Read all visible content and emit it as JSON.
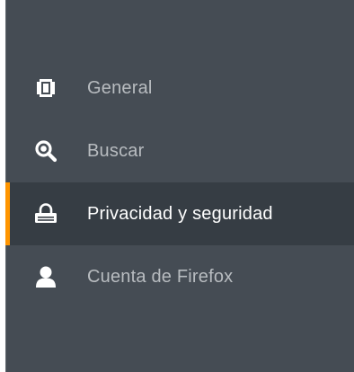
{
  "sidebar": {
    "items": [
      {
        "label": "General",
        "icon": "general-icon",
        "selected": false
      },
      {
        "label": "Buscar",
        "icon": "search-icon",
        "selected": false
      },
      {
        "label": "Privacidad y seguridad",
        "icon": "lock-icon",
        "selected": true
      },
      {
        "label": "Cuenta de Firefox",
        "icon": "account-icon",
        "selected": false
      }
    ],
    "colors": {
      "background": "#454c54",
      "selected_background": "#363d44",
      "accent": "#ff9500",
      "label": "#b8bcc0",
      "selected_label": "#ffffff"
    }
  }
}
